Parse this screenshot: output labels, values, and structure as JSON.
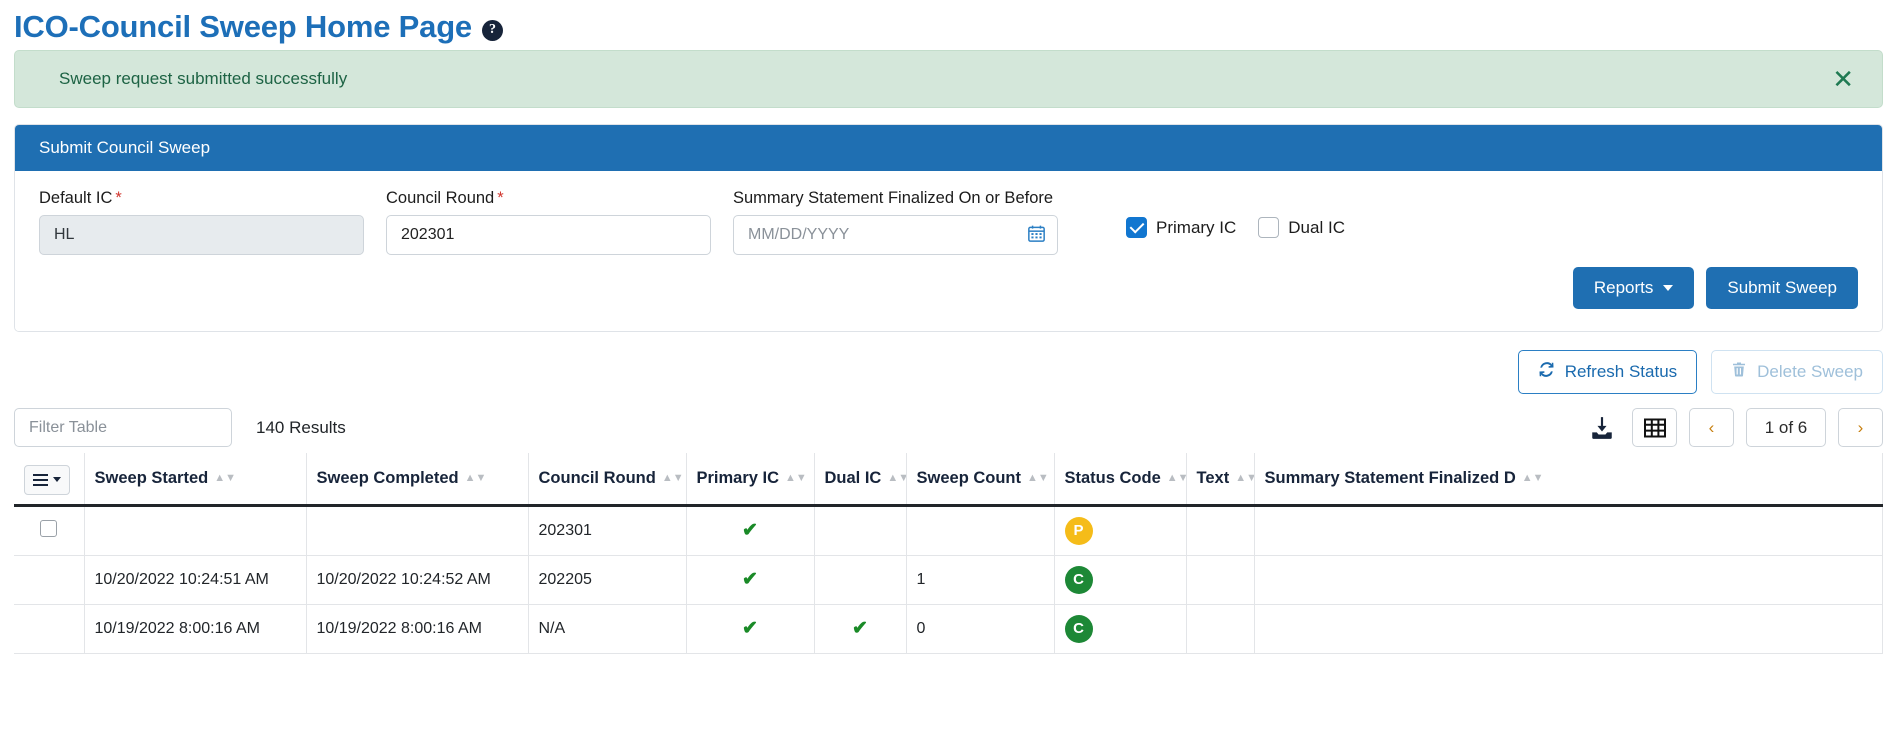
{
  "header": {
    "title": "ICO-Council Sweep Home Page",
    "help_icon": "question-circle-icon"
  },
  "alert": {
    "message": "Sweep request submitted successfully",
    "close_icon": "close-icon"
  },
  "card": {
    "title": "Submit Council Sweep",
    "fields": {
      "default_ic": {
        "label": "Default IC",
        "required": "*",
        "value": "HL"
      },
      "council_round": {
        "label": "Council Round",
        "required": "*",
        "value": "202301"
      },
      "summary_date": {
        "label": "Summary Statement Finalized On or Before",
        "placeholder": "MM/DD/YYYY",
        "value": "",
        "icon": "calendar-icon"
      }
    },
    "checkboxes": [
      {
        "label": "Primary IC",
        "checked": true
      },
      {
        "label": "Dual IC",
        "checked": false
      }
    ],
    "buttons": {
      "reports": "Reports",
      "submit": "Submit Sweep"
    }
  },
  "table_actions": {
    "refresh": "Refresh Status",
    "refresh_icon": "refresh-icon",
    "delete": "Delete Sweep",
    "delete_icon": "trash-icon"
  },
  "toolbar": {
    "filter_placeholder": "Filter Table",
    "filter_value": "",
    "results": "140 Results",
    "download_icon": "download-icon",
    "grid_icon": "table-grid-icon",
    "prev_icon": "chevron-left-icon",
    "next_icon": "chevron-right-icon",
    "page_indicator": "1 of 6"
  },
  "table": {
    "columns": [
      "Sweep Started",
      "Sweep Completed",
      "Council Round",
      "Primary IC",
      "Dual IC",
      "Sweep Count",
      "Status Code",
      "Text",
      "Summary Statement Finalized D"
    ],
    "rows": [
      {
        "selectable": true,
        "sweep_started": "",
        "sweep_completed": "",
        "council_round": "202301",
        "primary_ic": "✔",
        "dual_ic": "",
        "sweep_count": "",
        "status_code": "P",
        "status_color": "#f5bc19",
        "text": "",
        "summary_finalized": ""
      },
      {
        "selectable": false,
        "sweep_started": "10/20/2022 10:24:51 AM",
        "sweep_completed": "10/20/2022 10:24:52 AM",
        "council_round": "202205",
        "primary_ic": "✔",
        "dual_ic": "",
        "sweep_count": "1",
        "status_code": "C",
        "status_color": "#1d8836",
        "text": "",
        "summary_finalized": ""
      },
      {
        "selectable": false,
        "sweep_started": "10/19/2022 8:00:16 AM",
        "sweep_completed": "10/19/2022 8:00:16 AM",
        "council_round": "N/A",
        "primary_ic": "✔",
        "dual_ic": "✔",
        "sweep_count": "0",
        "status_code": "C",
        "status_color": "#1d8836",
        "text": "",
        "summary_finalized": ""
      }
    ]
  },
  "colors": {
    "brand_blue": "#1f6fb2",
    "title_blue": "#1d6fb8",
    "alert_green_bg": "#d4e7da",
    "status_pending": "#f5bc19",
    "status_complete": "#1d8836",
    "check_green": "#1a8a27"
  }
}
